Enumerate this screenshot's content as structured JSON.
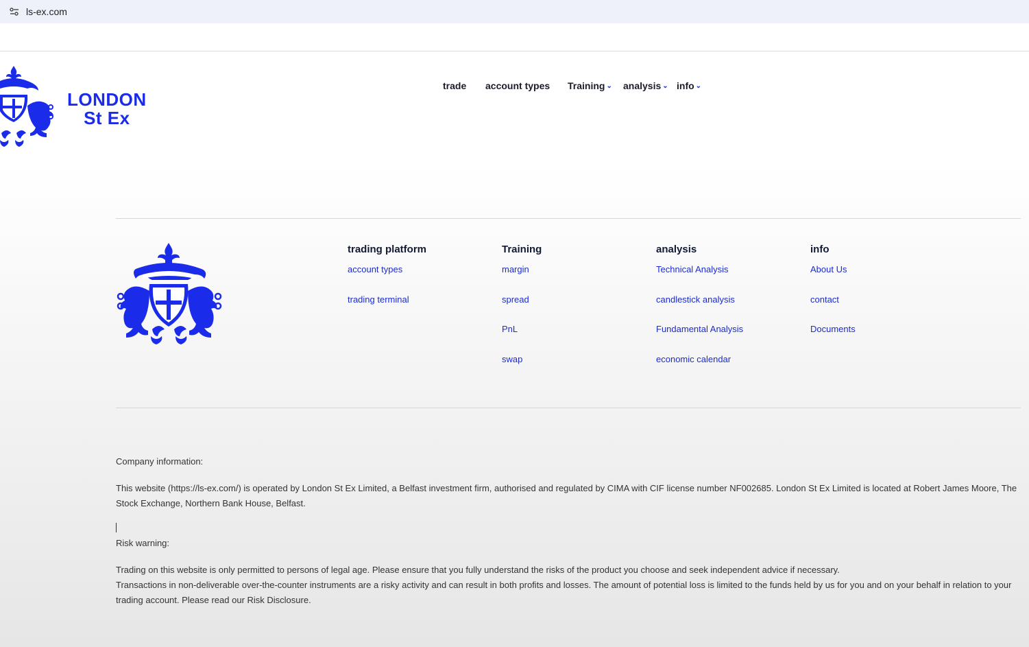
{
  "browser": {
    "url": "ls-ex.com",
    "site_info_icon": "tune-icon"
  },
  "logo": {
    "line1": "LONDON",
    "line2": "St Ex",
    "crest_icon": "heraldic-crest-icon",
    "color": "#1a2bea"
  },
  "nav": {
    "items": [
      {
        "label": "trade",
        "has_dropdown": false
      },
      {
        "label": "account types",
        "has_dropdown": false
      },
      {
        "label": "Training",
        "has_dropdown": true
      },
      {
        "label": "analysis",
        "has_dropdown": true
      },
      {
        "label": "info",
        "has_dropdown": true
      }
    ]
  },
  "footer": {
    "columns": [
      {
        "title": "trading platform",
        "links": [
          "account types",
          "trading terminal"
        ]
      },
      {
        "title": "Training",
        "links": [
          "margin",
          "spread",
          "PnL",
          "swap"
        ]
      },
      {
        "title": "analysis",
        "links": [
          "Technical Analysis",
          "candlestick analysis",
          "Fundamental Analysis",
          "economic calendar"
        ]
      },
      {
        "title": "info",
        "links": [
          "About Us",
          "contact",
          "Documents"
        ]
      }
    ],
    "company_heading": "Company information:",
    "company_text": "This website (https://ls-ex.com/) is operated by London St Ex Limited, a Belfast investment firm, authorised and regulated by CIMA with CIF license number NF002685. London St Ex Limited is located at Robert James Moore, The Stock Exchange, Northern Bank House, Belfast.",
    "risk_heading": "Risk warning:",
    "risk_text_1": "Trading on this website is only permitted to persons of legal age. Please ensure that you fully understand the risks of the product you choose and seek independent advice if necessary.",
    "risk_text_2": "Transactions in non-deliverable over-the-counter instruments are a risky activity and can result in both profits and losses. The amount of potential loss is limited to the funds held by us for you and on your behalf in relation to your trading account. Please read our Risk Disclosure."
  }
}
